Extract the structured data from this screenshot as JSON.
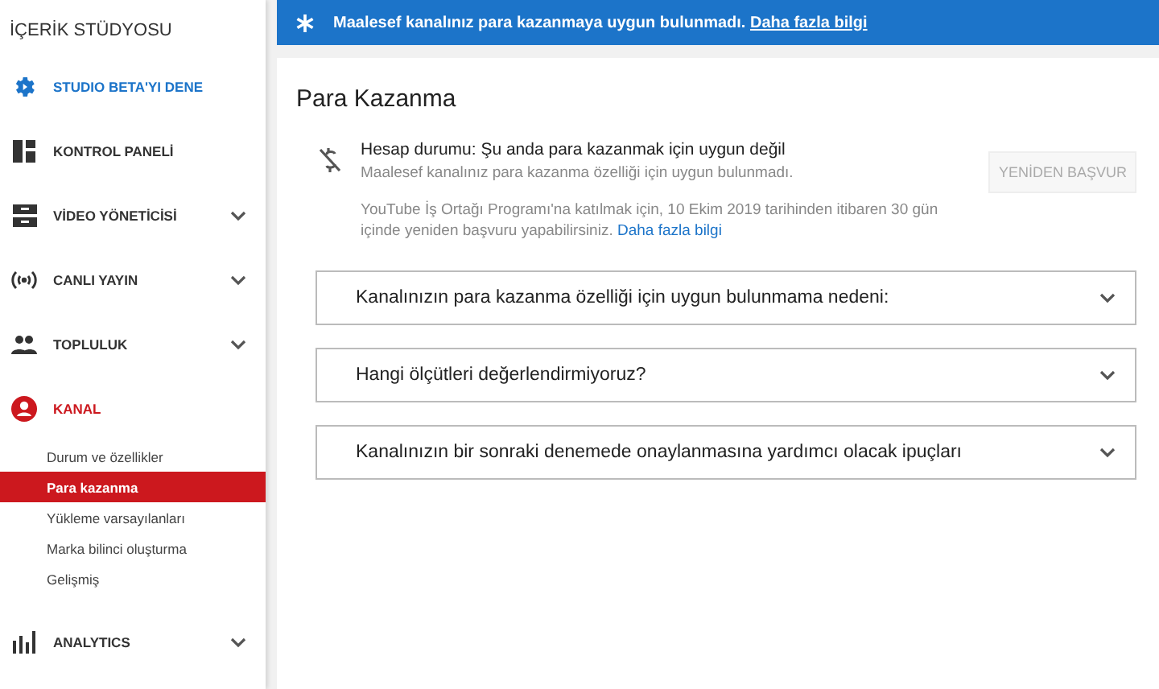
{
  "sidebar": {
    "title": "İÇERİK STÜDYOSU",
    "items": [
      {
        "label": "STUDIO BETA'YI DENE",
        "chevron": false,
        "selected": false,
        "highlight": true
      },
      {
        "label": "KONTROL PANELİ",
        "chevron": false,
        "selected": false,
        "highlight": false
      },
      {
        "label": "VİDEO YÖNETİCİSİ",
        "chevron": true,
        "selected": false,
        "highlight": false
      },
      {
        "label": "CANLI YAYIN",
        "chevron": true,
        "selected": false,
        "highlight": false
      },
      {
        "label": "TOPLULUK",
        "chevron": true,
        "selected": false,
        "highlight": false
      },
      {
        "label": "KANAL",
        "chevron": false,
        "selected": true,
        "highlight": false,
        "children": [
          {
            "label": "Durum ve özellikler",
            "selected": false
          },
          {
            "label": "Para kazanma",
            "selected": true
          },
          {
            "label": "Yükleme varsayılanları",
            "selected": false
          },
          {
            "label": "Marka bilinci oluşturma",
            "selected": false
          },
          {
            "label": "Gelişmiş",
            "selected": false
          }
        ]
      },
      {
        "label": "ANALYTICS",
        "chevron": true,
        "selected": false,
        "highlight": false
      }
    ]
  },
  "banner": {
    "message": "Maalesef kanalınız para kazanmaya uygun bulunmadı.",
    "link": "Daha fazla bilgi"
  },
  "card": {
    "title": "Para Kazanma",
    "status": {
      "heading": "Hesap durumu: Şu anda para kazanmak için uygun değil",
      "subtitle": "Maalesef kanalınız para kazanma özelliği için uygun bulunmadı.",
      "note": "YouTube İş Ortağı Programı'na katılmak için, 10 Ekim 2019 tarihinden itibaren 30 gün içinde yeniden başvuru yapabilirsiniz.",
      "link": "Daha fazla bilgi",
      "button": {
        "label": "YENİDEN BAŞVUR",
        "disabled": true
      }
    },
    "sections": [
      {
        "title": "Kanalınızın para kazanma özelliği için uygun bulunmama nedeni:",
        "expanded": false
      },
      {
        "title": "Hangi ölçütleri değerlendirmiyoruz?",
        "expanded": false
      },
      {
        "title": "Kanalınızın bir sonraki denemede onaylanmasına yardımcı olacak ipuçları",
        "expanded": false
      }
    ]
  }
}
